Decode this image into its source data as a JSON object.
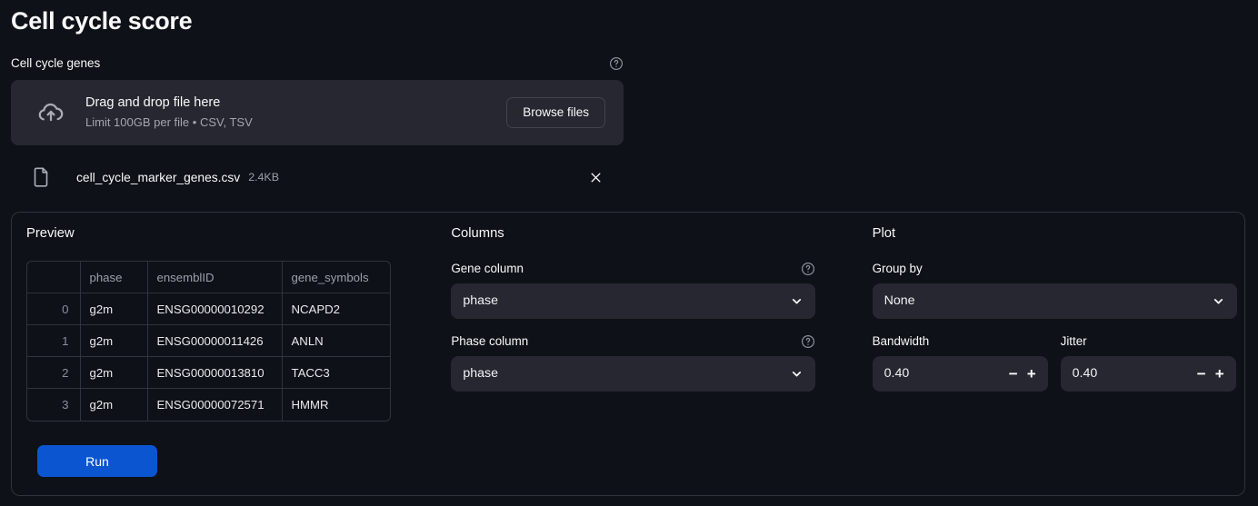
{
  "page": {
    "title": "Cell cycle score"
  },
  "uploader": {
    "label": "Cell cycle genes",
    "help_icon": "help-circle-icon",
    "dropzone": {
      "icon": "cloud-upload-icon",
      "main_text": "Drag and drop file here",
      "sub_text": "Limit 100GB per file • CSV, TSV",
      "browse_label": "Browse files"
    },
    "uploaded_file": {
      "icon": "file-document-icon",
      "name": "cell_cycle_marker_genes.csv",
      "size": "2.4KB",
      "remove_icon": "close-icon"
    }
  },
  "preview": {
    "title": "Preview",
    "columns": [
      "",
      "phase",
      "ensemblID",
      "gene_symbols"
    ],
    "rows": [
      [
        "0",
        "g2m",
        "ENSG00000010292",
        "NCAPD2"
      ],
      [
        "1",
        "g2m",
        "ENSG00000011426",
        "ANLN"
      ],
      [
        "2",
        "g2m",
        "ENSG00000013810",
        "TACC3"
      ],
      [
        "3",
        "g2m",
        "ENSG00000072571",
        "HMMR"
      ]
    ],
    "run_label": "Run"
  },
  "columns_section": {
    "title": "Columns",
    "gene_column": {
      "label": "Gene column",
      "value": "phase",
      "help_icon": "help-circle-icon",
      "chevron_icon": "chevron-down-icon"
    },
    "phase_column": {
      "label": "Phase column",
      "value": "phase",
      "help_icon": "help-circle-icon",
      "chevron_icon": "chevron-down-icon"
    }
  },
  "plot_section": {
    "title": "Plot",
    "group_by": {
      "label": "Group by",
      "value": "None",
      "chevron_icon": "chevron-down-icon"
    },
    "bandwidth": {
      "label": "Bandwidth",
      "value": "0.40",
      "decrement_label": "−",
      "increment_label": "+"
    },
    "jitter": {
      "label": "Jitter",
      "value": "0.40",
      "decrement_label": "−",
      "increment_label": "+"
    }
  },
  "colors": {
    "background": "#0e1117",
    "widget": "#262730",
    "border": "#31333d",
    "accent": "#0b56d0",
    "text": "#fafafa",
    "muted": "#9aa0ab"
  }
}
